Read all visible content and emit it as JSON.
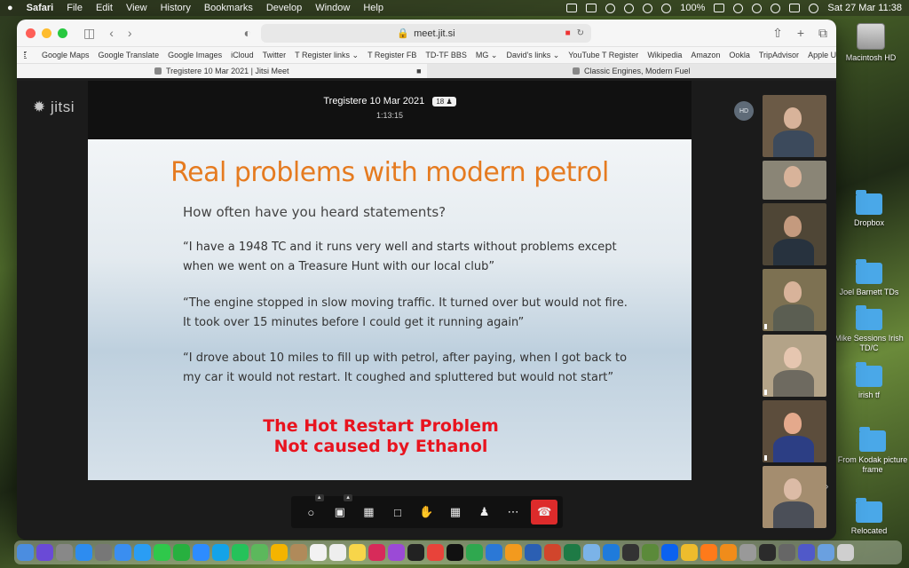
{
  "menubar": {
    "apple": "",
    "app": "Safari",
    "items": [
      "File",
      "Edit",
      "View",
      "History",
      "Bookmarks",
      "Develop",
      "Window",
      "Help"
    ],
    "battery": "100%",
    "datetime": "Sat 27 Mar  11:38"
  },
  "desktop": {
    "icons": [
      {
        "label": "Macintosh HD",
        "kind": "disk"
      },
      {
        "label": "Dropbox",
        "kind": "folder"
      },
      {
        "label": "Joel Barnett TDs",
        "kind": "folder"
      },
      {
        "label": "Mike Sessions Irish TD/C",
        "kind": "folder"
      },
      {
        "label": "irish tf",
        "kind": "folder"
      },
      {
        "label": "From Kodak picture frame",
        "kind": "folder"
      },
      {
        "label": "Relocated",
        "kind": "folder"
      }
    ]
  },
  "browser": {
    "url": "meet.jit.si",
    "bookmarks": [
      "Google Maps",
      "Google Translate",
      "Google Images",
      "iCloud",
      "Twitter",
      "T Register links ⌄",
      "T Register FB",
      "TD-TF BBS",
      "MG ⌄",
      "David's links ⌄",
      "YouTube T Register",
      "Wikipedia",
      "Amazon",
      "Ookla",
      "TripAdvisor",
      "Apple UK"
    ],
    "tabs": [
      {
        "title": "Tregistere 10 Mar 2021 | Jitsi Meet",
        "active": true
      },
      {
        "title": "Classic Engines, Modern Fuel",
        "active": false
      }
    ]
  },
  "meeting": {
    "logo": "jitsi",
    "title": "Tregistere 10 Mar 2021",
    "participant_count": "18",
    "elapsed": "1:13:15",
    "avatar_initials": "HD"
  },
  "slide": {
    "title": "Real problems with modern petrol",
    "intro": "How often have you heard statements?",
    "quotes": [
      "“I have a 1948 TC and it runs very well and starts without problems except when we went on a Treasure Hunt with our local club”",
      "“The engine stopped in slow moving traffic. It turned over but would not fire. It took over 15 minutes before I could get it running again”",
      "“I drove about 10 miles to fill up with petrol, after paying, when I got back to my car it would not restart. It coughed and spluttered but would not start”"
    ],
    "conclusion_line1": "The Hot Restart Problem",
    "conclusion_line2": "Not caused by Ethanol",
    "colors": {
      "title": "#e57b20",
      "conclusion": "#e8141f"
    }
  },
  "controls": {
    "buttons": [
      {
        "name": "mute-mic-button",
        "icon": "microphone-off-icon"
      },
      {
        "name": "camera-button",
        "icon": "camera-icon"
      },
      {
        "name": "share-screen-button",
        "icon": "screen-share-icon"
      },
      {
        "name": "chat-button",
        "icon": "chat-icon"
      },
      {
        "name": "raise-hand-button",
        "icon": "hand-icon"
      },
      {
        "name": "tile-view-button",
        "icon": "grid-icon"
      },
      {
        "name": "participants-button",
        "icon": "people-icon"
      },
      {
        "name": "more-actions-button",
        "icon": "more-icon"
      },
      {
        "name": "hangup-button",
        "icon": "phone-hangup-icon"
      }
    ],
    "hangup_color": "#dd2b2b"
  }
}
